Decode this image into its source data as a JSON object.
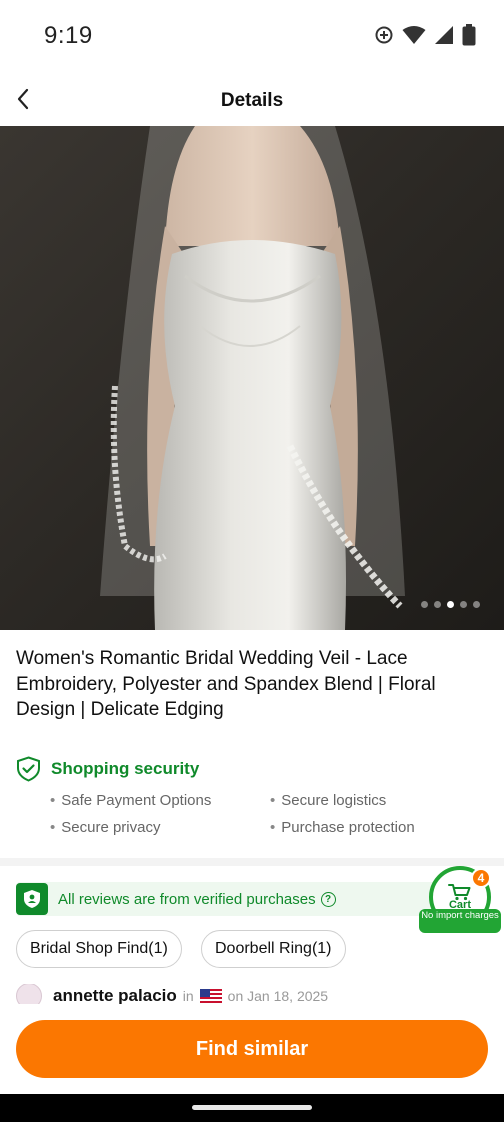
{
  "status_bar": {
    "time": "9:19"
  },
  "header": {
    "title": "Details"
  },
  "gallery": {
    "dot_count": 5,
    "active_index": 2
  },
  "product": {
    "title": "Women's Romantic Bridal Wedding Veil - Lace Embroidery, Polyester and Spandex Blend | Floral Design | Delicate Edging"
  },
  "security": {
    "title": "Shopping security",
    "items": [
      "Safe Payment Options",
      "Secure logistics",
      "Secure privacy",
      "Purchase protection"
    ]
  },
  "reviews": {
    "verified_text": "All reviews are from verified purchases",
    "chips": [
      "Bridal Shop Find(1)",
      "Doorbell Ring(1)"
    ],
    "reviewer": {
      "name": "annette palacio",
      "in_label": "in",
      "date": "on Jan 18, 2025"
    }
  },
  "cart": {
    "label": "Cart",
    "count": "4",
    "note": "No import charges"
  },
  "actions": {
    "find_similar": "Find similar"
  },
  "colors": {
    "accent": "#fb7701",
    "green": "#108a2b"
  }
}
